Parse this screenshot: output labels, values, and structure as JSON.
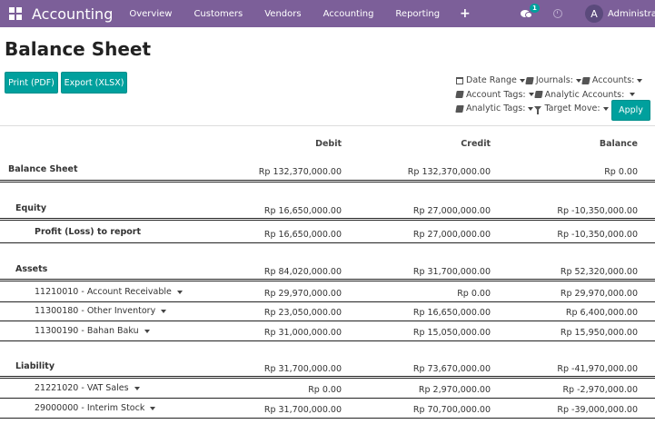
{
  "navbar": {
    "brand": "Accounting",
    "items": [
      "Overview",
      "Customers",
      "Vendors",
      "Accounting",
      "Reporting"
    ],
    "plus_label": "+",
    "chat_badge": "1",
    "avatar_initial": "A",
    "user_name": "Administrator",
    "bg_color": "#7c5f99"
  },
  "page": {
    "title": "Balance Sheet",
    "print_label": "Print (PDF)",
    "export_label": "Export (XLSX)",
    "apply_label": "Apply"
  },
  "filters": {
    "date_range": "Date Range",
    "journals": "Journals:",
    "accounts": "Accounts:",
    "account_tags": "Account Tags:",
    "analytic_accounts": "Analytic Accounts:",
    "analytic_tags": "Analytic Tags:",
    "target_move": "Target Move:"
  },
  "columns": {
    "debit": "Debit",
    "credit": "Credit",
    "balance": "Balance"
  },
  "rows": {
    "balance_sheet": {
      "label": "Balance Sheet",
      "debit": "Rp 132,370,000.00",
      "credit": "Rp 132,370,000.00",
      "balance": "Rp 0.00"
    },
    "equity": {
      "label": "Equity",
      "debit": "Rp 16,650,000.00",
      "credit": "Rp 27,000,000.00",
      "balance": "Rp -10,350,000.00"
    },
    "profit_loss": {
      "label": "Profit (Loss) to report",
      "debit": "Rp 16,650,000.00",
      "credit": "Rp 27,000,000.00",
      "balance": "Rp -10,350,000.00"
    },
    "assets": {
      "label": "Assets",
      "debit": "Rp 84,020,000.00",
      "credit": "Rp 31,700,000.00",
      "balance": "Rp 52,320,000.00"
    },
    "acc_receivable": {
      "label": "11210010 - Account Receivable",
      "debit": "Rp 29,970,000.00",
      "credit": "Rp 0.00",
      "balance": "Rp 29,970,000.00"
    },
    "other_inventory": {
      "label": "11300180 - Other Inventory",
      "debit": "Rp 23,050,000.00",
      "credit": "Rp 16,650,000.00",
      "balance": "Rp 6,400,000.00"
    },
    "bahan_baku": {
      "label": "11300190 - Bahan Baku",
      "debit": "Rp 31,000,000.00",
      "credit": "Rp 15,050,000.00",
      "balance": "Rp 15,950,000.00"
    },
    "liability": {
      "label": "Liability",
      "debit": "Rp 31,700,000.00",
      "credit": "Rp 73,670,000.00",
      "balance": "Rp -41,970,000.00"
    },
    "vat_sales": {
      "label": "21221020 - VAT Sales",
      "debit": "Rp 0.00",
      "credit": "Rp 2,970,000.00",
      "balance": "Rp -2,970,000.00"
    },
    "interim_stock": {
      "label": "29000000 - Interim Stock",
      "debit": "Rp 31,700,000.00",
      "credit": "Rp 70,700,000.00",
      "balance": "Rp -39,000,000.00"
    }
  }
}
